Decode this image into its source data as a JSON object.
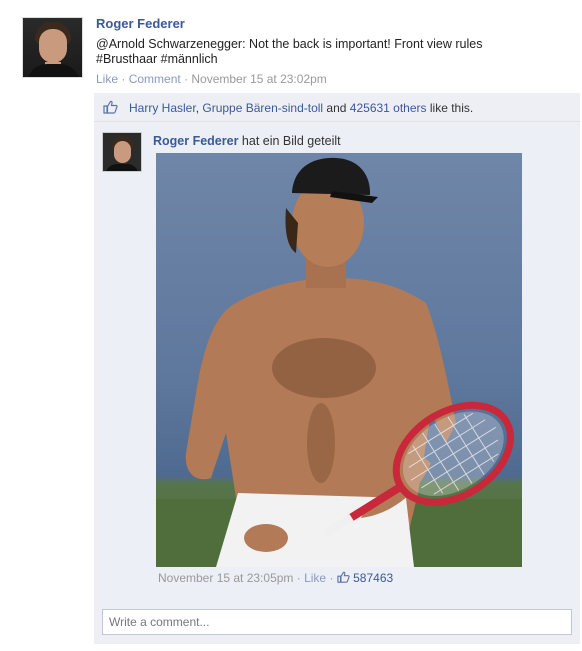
{
  "post": {
    "author": "Roger Federer",
    "status_line1": "@Arnold Schwarzenegger: Not the back is important! Front view rules",
    "status_line2": "#Brusthaar #männlich",
    "like_label": "Like",
    "comment_label": "Comment",
    "sep": " · ",
    "timestamp": "November 15 at 23:02pm"
  },
  "likes": {
    "icon": "thumbs-up-icon",
    "user1": "Harry Hasler",
    "sep": ", ",
    "user2": "Gruppe Bären-sind-toll",
    "and": " and ",
    "others": "425631 others",
    "tail": " like this."
  },
  "shared": {
    "name": "Roger Federer",
    "action": " hat ein Bild geteilt",
    "timestamp": "November 15 at 23:05pm",
    "sep": " · ",
    "like_label": "Like",
    "like_count": "587463"
  },
  "comment": {
    "placeholder": "Write a comment..."
  },
  "colors": {
    "link": "#3b5998",
    "feedback_bg": "#edeff4",
    "muted": "#999999"
  }
}
